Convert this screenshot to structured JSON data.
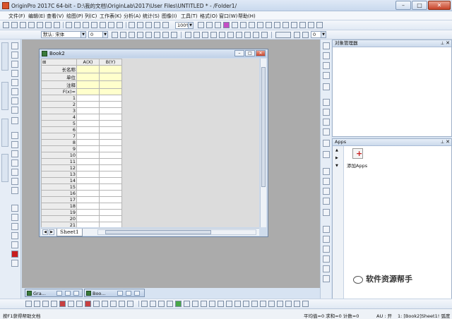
{
  "window": {
    "title": "OriginPro 2017C 64-bit - D:\\我的文档\\OriginLab\\2017\\User Files\\UNTITLED * - /Folder1/",
    "min": "–",
    "max": "□",
    "close": "✕"
  },
  "menu": [
    "文件(F)",
    "编辑(E)",
    "查看(V)",
    "绘图(P)",
    "列(C)",
    "工作表(K)",
    "分析(A)",
    "统计(S)",
    "图像(I)",
    "工具(T)",
    "格式(O)",
    "窗口(W)",
    "帮助(H)"
  ],
  "toolbar": {
    "zoom": "100%",
    "font": "默认: 宋体",
    "font_size": "0",
    "size2": "0"
  },
  "book": {
    "title": "Book2",
    "columns": [
      "A(X)",
      "B(Y)"
    ],
    "meta_rows": [
      "长名称",
      "单位",
      "注释",
      "F(x)="
    ],
    "row_numbers": [
      "1",
      "2",
      "3",
      "4",
      "5",
      "6",
      "7",
      "8",
      "9",
      "10",
      "11",
      "12",
      "13",
      "14",
      "15",
      "16",
      "17",
      "18",
      "19",
      "20",
      "21",
      "22",
      "23"
    ],
    "sheet_tab": "Sheet1"
  },
  "minimized": [
    "Gra...",
    "Boo..."
  ],
  "panels": {
    "object_manager": "对象管理器",
    "apps": "Apps",
    "add_apps": "添加Apps"
  },
  "status": {
    "left": "按F1获得帮助文档",
    "stats": "平均值=0 求和=0 计数=0",
    "au": "AU : 开",
    "sheet": "1: [Book2]Sheet1! 弧度"
  },
  "watermark": "软件资源帮手"
}
